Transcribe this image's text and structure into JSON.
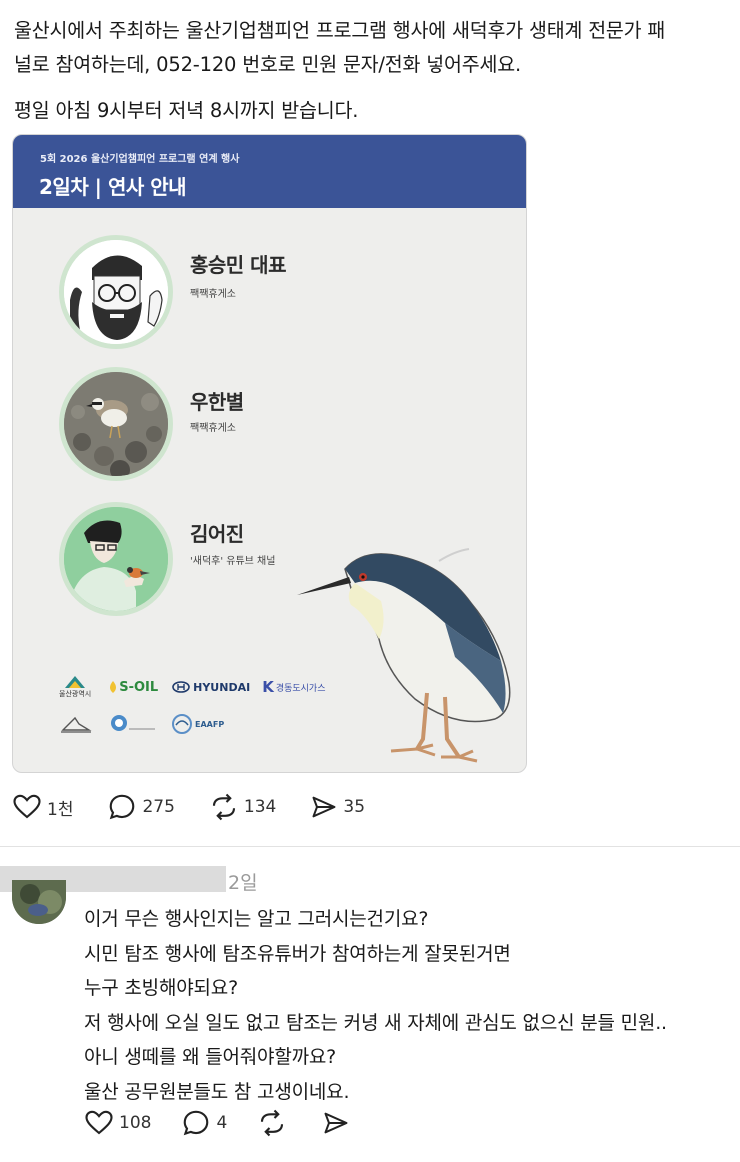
{
  "post": {
    "line1": "울산시에서 주최하는 울산기업챔피언 프로그램 행사에 새덕후가 생태계 전문가 패",
    "line2": "널로 참여하는데, 052-120 번호로 민원 문자/전화 넣어주세요.",
    "line3": "평일 아침 9시부터 저녁 8시까지 받습니다."
  },
  "card": {
    "subtitle": "5회 2026 울산기업챔피언 프로그램 연계 행사",
    "title": "2일차 | 연사 안내",
    "header_color": "#3b5497",
    "speakers": [
      {
        "name": "홍승민 대표",
        "role": "짹짹휴게소"
      },
      {
        "name": "우한별",
        "role": "짹짹휴게소"
      },
      {
        "name": "김어진",
        "role": "'새덕후' 유튜브 채널"
      }
    ],
    "logos": {
      "ulsan": "울산광역시",
      "soil": "S-OIL",
      "hyundai": "HYUNDAI",
      "kyungdong": "경동도시가스",
      "eaafp": "EAAFP"
    }
  },
  "post_actions": {
    "likes": "1천",
    "comments": "275",
    "reposts": "134",
    "shares": "35"
  },
  "comment": {
    "time": "2일",
    "lines": [
      "이거 무슨 행사인지는 알고 그러시는건기요?",
      "시민 탐조 행사에 탐조유튜버가 참여하는게 잘못된거면",
      "누구 초빙해야되요?",
      "저 행사에 오실 일도 없고 탐조는 커녕 새 자체에 관심도 없으신 분들 민원..",
      "아니 생떼를 왜 들어줘야할까요?",
      "울산 공무원분들도 참 고생이네요."
    ],
    "likes": "108",
    "replies": "4"
  },
  "icons": {
    "like": "heart-icon",
    "comment": "speech-bubble-icon",
    "repost": "repost-icon",
    "share": "send-icon"
  }
}
